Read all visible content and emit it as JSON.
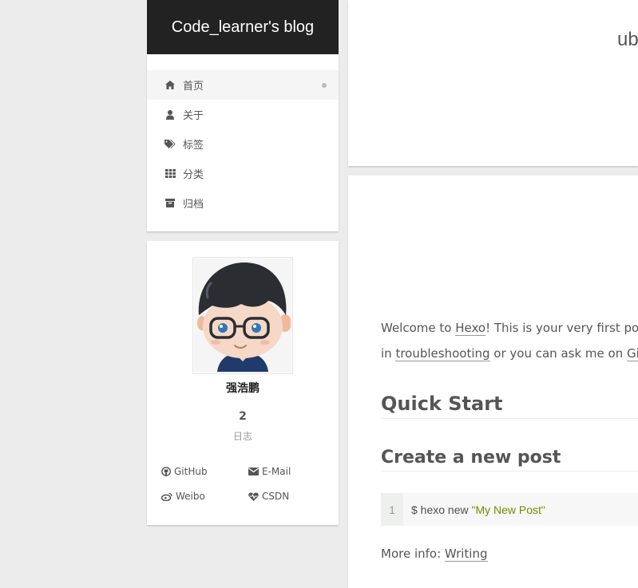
{
  "site": {
    "brand": "Code_learner's blog"
  },
  "menu": {
    "items": [
      {
        "label": "首页",
        "icon": "home-icon",
        "active": true
      },
      {
        "label": "关于",
        "icon": "user-icon",
        "active": false
      },
      {
        "label": "标签",
        "icon": "tags-icon",
        "active": false
      },
      {
        "label": "分类",
        "icon": "th-icon",
        "active": false
      },
      {
        "label": "归档",
        "icon": "archive-icon",
        "active": false
      }
    ]
  },
  "author": {
    "name": "强浩鹏",
    "posts_count": "2",
    "posts_label": "日志",
    "links": [
      {
        "label": "GitHub",
        "icon": "github-icon"
      },
      {
        "label": "E-Mail",
        "icon": "envelope-icon"
      },
      {
        "label": "Weibo",
        "icon": "weibo-icon"
      },
      {
        "label": "CSDN",
        "icon": "heartbeat-icon"
      }
    ]
  },
  "header": {
    "title_fragment": "ub"
  },
  "post": {
    "intro": {
      "prefix": "Welcome to ",
      "hexo_link": "Hexo",
      "suffix": "! This is your very first post."
    },
    "line2": {
      "prefix": "in ",
      "troubleshooting_link": "troubleshooting",
      "middle": " or you can ask me on ",
      "github_link": "GitHu"
    },
    "h_quick_start": "Quick Start",
    "h_create_post": "Create a new post",
    "code": {
      "line_no": "1",
      "command": "$ hexo new ",
      "string": "\"My New Post\""
    },
    "more_info": {
      "prefix": "More info: ",
      "link": "Writing"
    }
  },
  "colors": {
    "brand_bg": "#222222",
    "page_bg": "#ececec",
    "code_string": "#718c00"
  }
}
